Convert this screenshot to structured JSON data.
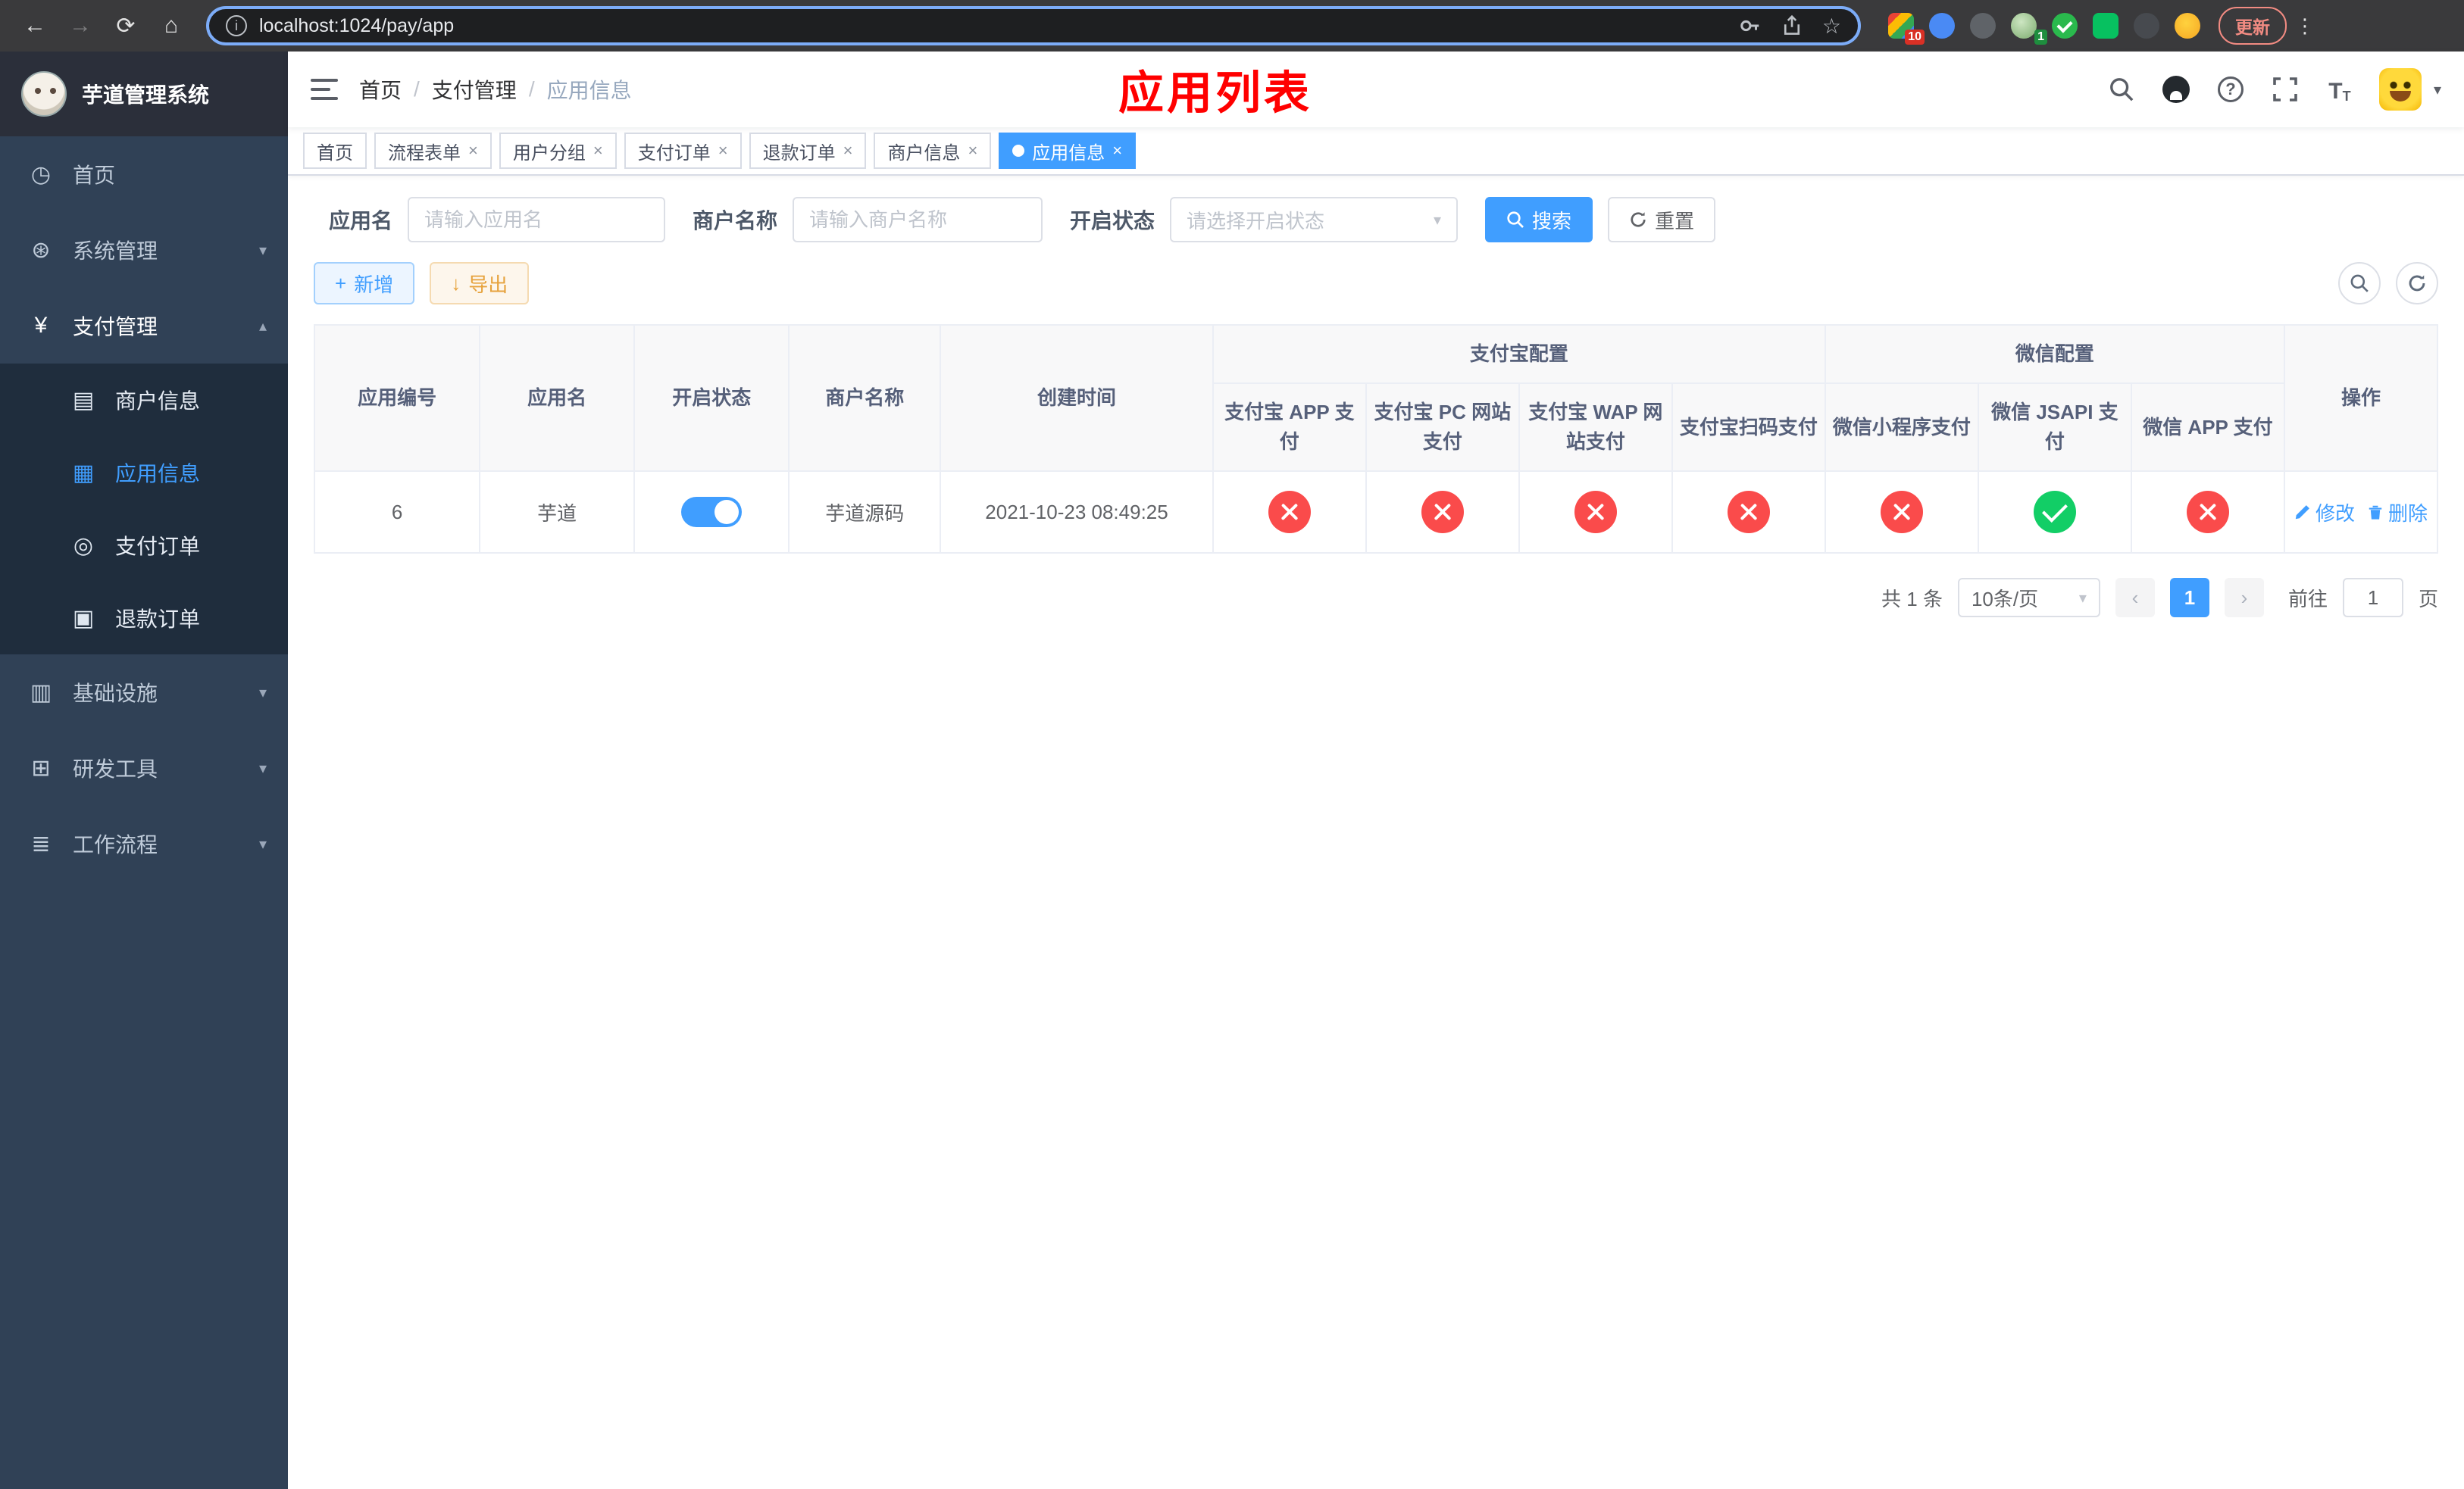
{
  "browser": {
    "url": "localhost:1024/pay/app",
    "update_button": "更新",
    "extension_badge_count": "10",
    "avatar_badge_count": "1"
  },
  "sidebar": {
    "title": "芋道管理系统",
    "home": "首页",
    "system": "系统管理",
    "payment": "支付管理",
    "merchant_info": "商户信息",
    "app_info": "应用信息",
    "pay_order": "支付订单",
    "refund_order": "退款订单",
    "infra": "基础设施",
    "dev_tools": "研发工具",
    "workflow": "工作流程"
  },
  "header": {
    "breadcrumb": [
      "首页",
      "支付管理",
      "应用信息"
    ],
    "annotation_title": "应用列表"
  },
  "tabs": [
    {
      "label": "首页"
    },
    {
      "label": "流程表单"
    },
    {
      "label": "用户分组"
    },
    {
      "label": "支付订单"
    },
    {
      "label": "退款订单"
    },
    {
      "label": "商户信息"
    },
    {
      "label": "应用信息"
    }
  ],
  "filters": {
    "app_name_label": "应用名",
    "app_name_placeholder": "请输入应用名",
    "merchant_label": "商户名称",
    "merchant_placeholder": "请输入商户名称",
    "status_label": "开启状态",
    "status_placeholder": "请选择开启状态",
    "search_button": "搜索",
    "reset_button": "重置"
  },
  "toolbar": {
    "add_button": "新增",
    "export_button": "导出"
  },
  "table": {
    "group_headers": {
      "alipay": "支付宝配置",
      "wechat": "微信配置"
    },
    "columns": [
      "应用编号",
      "应用名",
      "开启状态",
      "商户名称",
      "创建时间",
      "支付宝 APP 支付",
      "支付宝 PC 网站支付",
      "支付宝 WAP 网站支付",
      "支付宝扫码支付",
      "微信小程序支付",
      "微信 JSAPI 支付",
      "微信 APP 支付",
      "操作"
    ],
    "rows": [
      {
        "id": "6",
        "name": "芋道",
        "enabled": true,
        "merchant": "芋道源码",
        "created": "2021-10-23 08:49:25",
        "alipay_app": false,
        "alipay_pc": false,
        "alipay_wap": false,
        "alipay_qr": false,
        "wechat_mini": false,
        "wechat_jsapi": true,
        "wechat_app": false,
        "edit_label": "修改",
        "delete_label": "删除"
      }
    ]
  },
  "pagination": {
    "total_text": "共 1 条",
    "page_size": "10条/页",
    "current_page": "1",
    "goto_label": "前往",
    "goto_value": "1",
    "goto_suffix": "页"
  },
  "colors": {
    "primary": "#409eff",
    "danger_circle": "#fa4b4b",
    "success_circle": "#12ce66",
    "warning": "#e6a23c",
    "sidebar_bg": "#304156",
    "submenu_bg": "#1f2d3d",
    "annotation_red": "#ff0000"
  }
}
